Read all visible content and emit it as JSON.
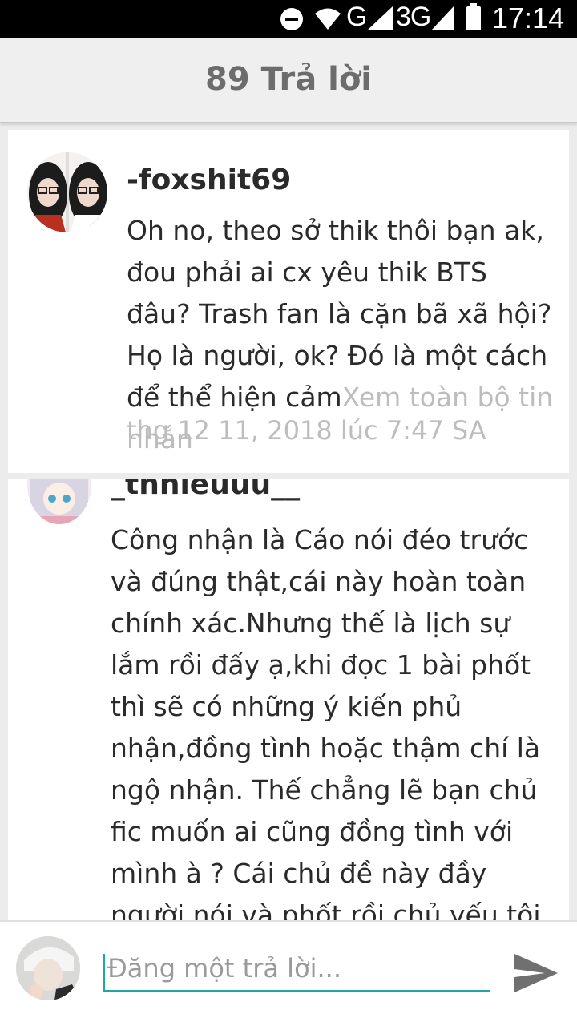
{
  "status_bar": {
    "network_g": "G",
    "network_3g": "3G",
    "time": "17:14"
  },
  "header": {
    "title": "89 Trả lời"
  },
  "comments": [
    {
      "username": "-foxshit69",
      "message": "Oh no, theo sở thik thôi bạn ak, đou phải ai cx yêu thik BTS đâu? Trash fan là cặn bã xã hội? Họ là người, ok? Đó là một cách để thể hiện cảm",
      "see_more": "Xem toàn bộ tin nhắn",
      "timestamp": "thg 12 11, 2018 lúc 7:47 SA"
    },
    {
      "username": "_thhieuuu__",
      "message": "Công nhận là Cáo nói đéo trước và đúng thật,cái này hoàn toàn chính xác.Nhưng thế là lịch sự lắm rồi đấy ạ,khi đọc 1 bài phốt thì sẽ có những ý kiến phủ nhận,đồng tình hoặc thậm chí là ngộ nhận. Thế chẳng lẽ bạn chủ fic muốn ai cũng đồng tình với mình à ? Cái chủ đề này đầy người nói và phốt rồi,chủ yếu tôi thấy nhiều bạn nhai lại chỉ"
    }
  ],
  "reply": {
    "placeholder": "Đăng một trả lời..."
  },
  "icons": {
    "dnd": "do-not-disturb-icon",
    "wifi": "wifi-icon",
    "signal": "signal-icon",
    "battery": "battery-icon",
    "send": "send-icon"
  },
  "colors": {
    "accent": "#1fa7a3",
    "header_text": "#6c6c6c",
    "muted_text": "#bdbdbd"
  }
}
